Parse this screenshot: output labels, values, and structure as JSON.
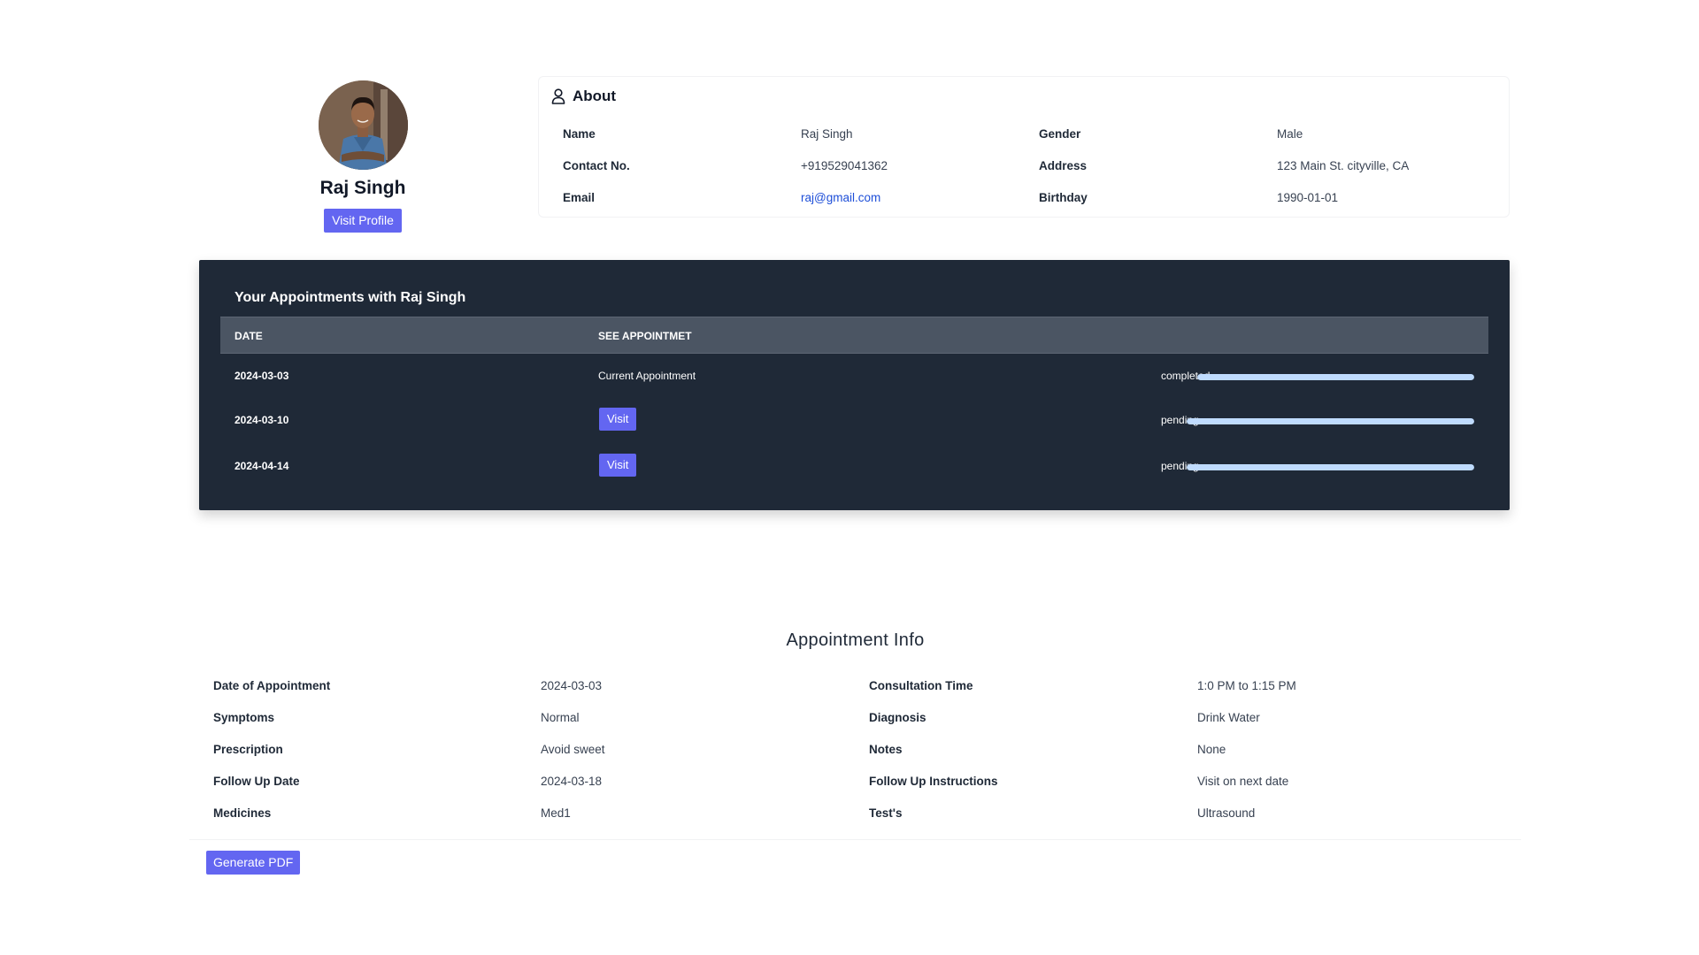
{
  "profile": {
    "name": "Raj Singh",
    "visit_profile_label": "Visit Profile"
  },
  "about": {
    "title": "About",
    "icon": "user-icon",
    "rows": [
      {
        "label1": "Name",
        "value1": "Raj Singh",
        "label2": "Gender",
        "value2": "Male"
      },
      {
        "label1": "Contact No.",
        "value1": "+919529041362",
        "label2": "Address",
        "value2": "123 Main St. cityville, CA"
      },
      {
        "label1": "Email",
        "value1": "raj@gmail.com",
        "label2": "Birthday",
        "value2": "1990-01-01"
      }
    ]
  },
  "appointments": {
    "title": "Your Appointments with Raj Singh",
    "headers": {
      "date": "DATE",
      "see": "SEE APPOINTMET"
    },
    "rows": [
      {
        "date": "2024-03-03",
        "action": "Current Appointment",
        "status": "completed",
        "progress": 1.0
      },
      {
        "date": "2024-03-10",
        "action": "Visit",
        "status": "pending",
        "progress": 1.0
      },
      {
        "date": "2024-04-14",
        "action": "Visit",
        "status": "pending",
        "progress": 1.0
      }
    ],
    "progress_color": "#bfdbfe"
  },
  "appointment_info": {
    "title": "Appointment Info",
    "rows": [
      {
        "label1": "Date of Appointment",
        "value1": "2024-03-03",
        "label2": "Consultation Time",
        "value2": "1:0 PM to 1:15 PM"
      },
      {
        "label1": "Symptoms",
        "value1": "Normal",
        "label2": "Diagnosis",
        "value2": "Drink Water"
      },
      {
        "label1": "Prescription",
        "value1": "Avoid sweet",
        "label2": "Notes",
        "value2": "None"
      },
      {
        "label1": "Follow Up Date",
        "value1": "2024-03-18",
        "label2": "Follow Up Instructions",
        "value2": "Visit on next date"
      },
      {
        "label1": "Medicines",
        "value1": "Med1",
        "label2": "Test's",
        "value2": "Ultrasound"
      }
    ]
  },
  "actions": {
    "generate_pdf_label": "Generate PDF"
  },
  "colors": {
    "accent": "#6366f1",
    "panel_dark": "#1f2937",
    "table_header": "#4b5563",
    "link": "#1d4ed8"
  }
}
